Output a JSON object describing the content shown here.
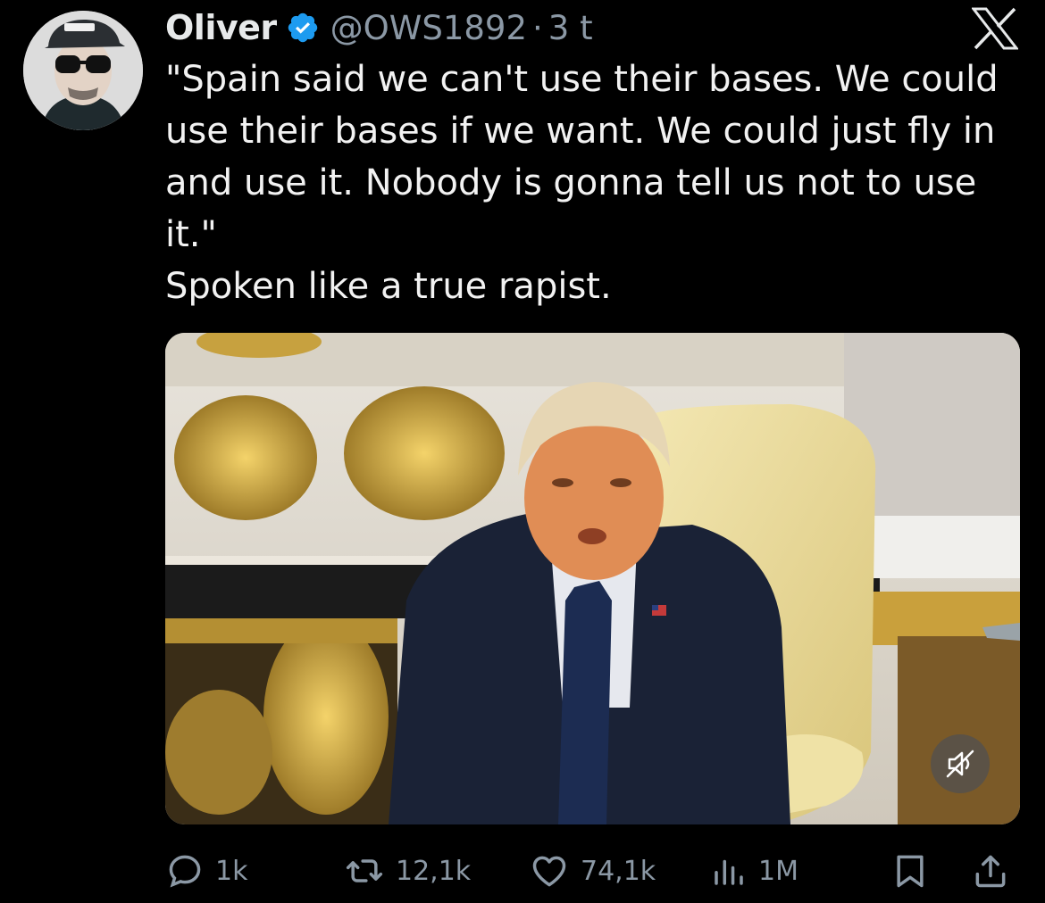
{
  "author": {
    "name": "Oliver",
    "handle": "@OWS1892",
    "separator": "·",
    "time": "3 t",
    "verified": true,
    "avatar_icon": "user-avatar-icon"
  },
  "platform_logo": "x-logo-icon",
  "tweet": {
    "lines": [
      "\"Spain said we can't use their bases. We could use their bases if we want. We could just fly in and use it. Nobody is gonna tell us not to use it.\"",
      "Spoken like a true rapist."
    ]
  },
  "media": {
    "type": "video",
    "mute_icon": "muted-speaker-icon"
  },
  "actions": {
    "replies": {
      "icon": "reply-icon",
      "count": "1k"
    },
    "reposts": {
      "icon": "repost-icon",
      "count": "12,1k"
    },
    "likes": {
      "icon": "heart-icon",
      "count": "74,1k"
    },
    "views": {
      "icon": "views-icon",
      "count": "1M"
    },
    "bookmark": {
      "icon": "bookmark-icon"
    },
    "share": {
      "icon": "share-icon"
    }
  },
  "colors": {
    "background": "#000000",
    "text": "#e7e9ea",
    "muted": "#8b98a5",
    "verified": "#1d9bf0"
  }
}
